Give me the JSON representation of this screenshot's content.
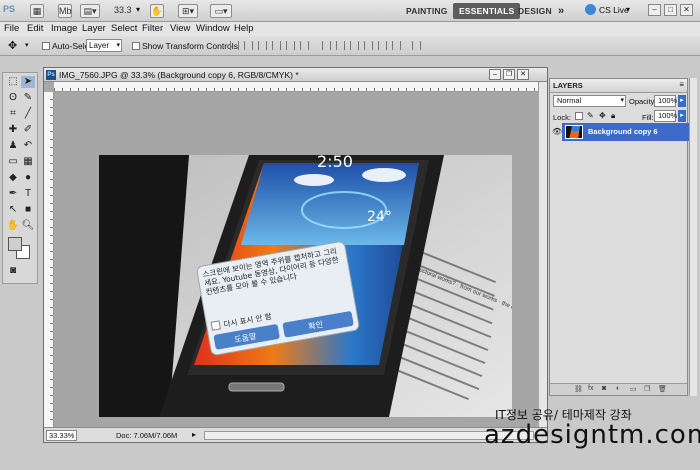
{
  "app_bar": {
    "logo": "PS",
    "zoom": "33.3",
    "workspaces": [
      "PAINTING",
      "ESSENTIALS",
      "DESIGN"
    ],
    "active_workspace": "ESSENTIALS",
    "more": "»",
    "cs_live": "CS Live",
    "window_controls": [
      "–",
      "□",
      "✕"
    ]
  },
  "menu": [
    "File",
    "Edit",
    "Image",
    "Layer",
    "Select",
    "Filter",
    "View",
    "Window",
    "Help"
  ],
  "options_bar": {
    "auto_select_label": "Auto-Select:",
    "auto_select_value": "Layer",
    "show_transform_label": "Show Transform Controls"
  },
  "document": {
    "title": "IMG_7560.JPG @ 33.3% (Background copy 6, RGB/8/CMYK) *",
    "zoom": "33.33%",
    "doc_info": "Doc: 7.06M/7.06M"
  },
  "photo": {
    "time": "2:50",
    "temperature": "24°",
    "dialog_text": "스크린에 보이는 영역 주위를 캡처하고 그리세요. Youtube 동영상, 다이어리 등 다양한 컨텐츠를 모아 볼 수 있습니다",
    "dialog_check": "다시 표시 안 함",
    "dialog_help": "도움말",
    "dialog_ok": "확인",
    "book_text": "of architectural works? · from our works · the creativity ·"
  },
  "layers_panel": {
    "tab": "LAYERS",
    "blend_mode": "Normal",
    "opacity_label": "Opacity:",
    "opacity_value": "100%",
    "lock_label": "Lock:",
    "fill_label": "Fill:",
    "fill_value": "100%",
    "layer_name": "Background copy 6"
  },
  "watermark": {
    "line1": "IT정보 공유/ 테마제작 강좌",
    "line2": "azdesigntm.com"
  },
  "colors": {
    "accent": "#3d6bc7",
    "active_workspace_bg": "#5d5d5d"
  }
}
